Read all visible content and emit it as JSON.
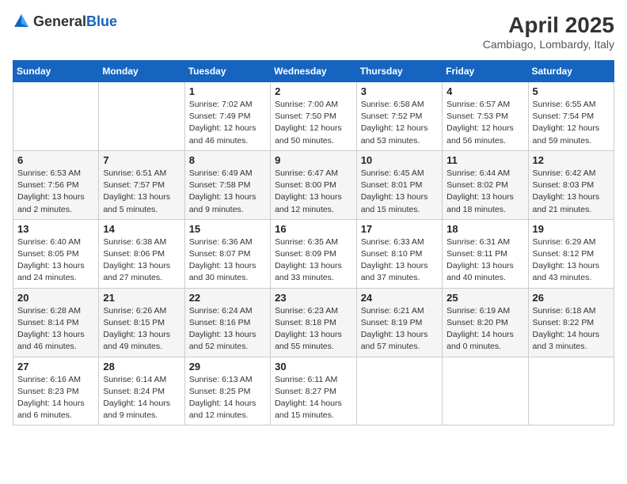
{
  "logo": {
    "general": "General",
    "blue": "Blue"
  },
  "title": "April 2025",
  "subtitle": "Cambiago, Lombardy, Italy",
  "header": {
    "days": [
      "Sunday",
      "Monday",
      "Tuesday",
      "Wednesday",
      "Thursday",
      "Friday",
      "Saturday"
    ]
  },
  "weeks": [
    [
      {
        "day": "",
        "info": ""
      },
      {
        "day": "",
        "info": ""
      },
      {
        "day": "1",
        "info": "Sunrise: 7:02 AM\nSunset: 7:49 PM\nDaylight: 12 hours and 46 minutes."
      },
      {
        "day": "2",
        "info": "Sunrise: 7:00 AM\nSunset: 7:50 PM\nDaylight: 12 hours and 50 minutes."
      },
      {
        "day": "3",
        "info": "Sunrise: 6:58 AM\nSunset: 7:52 PM\nDaylight: 12 hours and 53 minutes."
      },
      {
        "day": "4",
        "info": "Sunrise: 6:57 AM\nSunset: 7:53 PM\nDaylight: 12 hours and 56 minutes."
      },
      {
        "day": "5",
        "info": "Sunrise: 6:55 AM\nSunset: 7:54 PM\nDaylight: 12 hours and 59 minutes."
      }
    ],
    [
      {
        "day": "6",
        "info": "Sunrise: 6:53 AM\nSunset: 7:56 PM\nDaylight: 13 hours and 2 minutes."
      },
      {
        "day": "7",
        "info": "Sunrise: 6:51 AM\nSunset: 7:57 PM\nDaylight: 13 hours and 5 minutes."
      },
      {
        "day": "8",
        "info": "Sunrise: 6:49 AM\nSunset: 7:58 PM\nDaylight: 13 hours and 9 minutes."
      },
      {
        "day": "9",
        "info": "Sunrise: 6:47 AM\nSunset: 8:00 PM\nDaylight: 13 hours and 12 minutes."
      },
      {
        "day": "10",
        "info": "Sunrise: 6:45 AM\nSunset: 8:01 PM\nDaylight: 13 hours and 15 minutes."
      },
      {
        "day": "11",
        "info": "Sunrise: 6:44 AM\nSunset: 8:02 PM\nDaylight: 13 hours and 18 minutes."
      },
      {
        "day": "12",
        "info": "Sunrise: 6:42 AM\nSunset: 8:03 PM\nDaylight: 13 hours and 21 minutes."
      }
    ],
    [
      {
        "day": "13",
        "info": "Sunrise: 6:40 AM\nSunset: 8:05 PM\nDaylight: 13 hours and 24 minutes."
      },
      {
        "day": "14",
        "info": "Sunrise: 6:38 AM\nSunset: 8:06 PM\nDaylight: 13 hours and 27 minutes."
      },
      {
        "day": "15",
        "info": "Sunrise: 6:36 AM\nSunset: 8:07 PM\nDaylight: 13 hours and 30 minutes."
      },
      {
        "day": "16",
        "info": "Sunrise: 6:35 AM\nSunset: 8:09 PM\nDaylight: 13 hours and 33 minutes."
      },
      {
        "day": "17",
        "info": "Sunrise: 6:33 AM\nSunset: 8:10 PM\nDaylight: 13 hours and 37 minutes."
      },
      {
        "day": "18",
        "info": "Sunrise: 6:31 AM\nSunset: 8:11 PM\nDaylight: 13 hours and 40 minutes."
      },
      {
        "day": "19",
        "info": "Sunrise: 6:29 AM\nSunset: 8:12 PM\nDaylight: 13 hours and 43 minutes."
      }
    ],
    [
      {
        "day": "20",
        "info": "Sunrise: 6:28 AM\nSunset: 8:14 PM\nDaylight: 13 hours and 46 minutes."
      },
      {
        "day": "21",
        "info": "Sunrise: 6:26 AM\nSunset: 8:15 PM\nDaylight: 13 hours and 49 minutes."
      },
      {
        "day": "22",
        "info": "Sunrise: 6:24 AM\nSunset: 8:16 PM\nDaylight: 13 hours and 52 minutes."
      },
      {
        "day": "23",
        "info": "Sunrise: 6:23 AM\nSunset: 8:18 PM\nDaylight: 13 hours and 55 minutes."
      },
      {
        "day": "24",
        "info": "Sunrise: 6:21 AM\nSunset: 8:19 PM\nDaylight: 13 hours and 57 minutes."
      },
      {
        "day": "25",
        "info": "Sunrise: 6:19 AM\nSunset: 8:20 PM\nDaylight: 14 hours and 0 minutes."
      },
      {
        "day": "26",
        "info": "Sunrise: 6:18 AM\nSunset: 8:22 PM\nDaylight: 14 hours and 3 minutes."
      }
    ],
    [
      {
        "day": "27",
        "info": "Sunrise: 6:16 AM\nSunset: 8:23 PM\nDaylight: 14 hours and 6 minutes."
      },
      {
        "day": "28",
        "info": "Sunrise: 6:14 AM\nSunset: 8:24 PM\nDaylight: 14 hours and 9 minutes."
      },
      {
        "day": "29",
        "info": "Sunrise: 6:13 AM\nSunset: 8:25 PM\nDaylight: 14 hours and 12 minutes."
      },
      {
        "day": "30",
        "info": "Sunrise: 6:11 AM\nSunset: 8:27 PM\nDaylight: 14 hours and 15 minutes."
      },
      {
        "day": "",
        "info": ""
      },
      {
        "day": "",
        "info": ""
      },
      {
        "day": "",
        "info": ""
      }
    ]
  ]
}
